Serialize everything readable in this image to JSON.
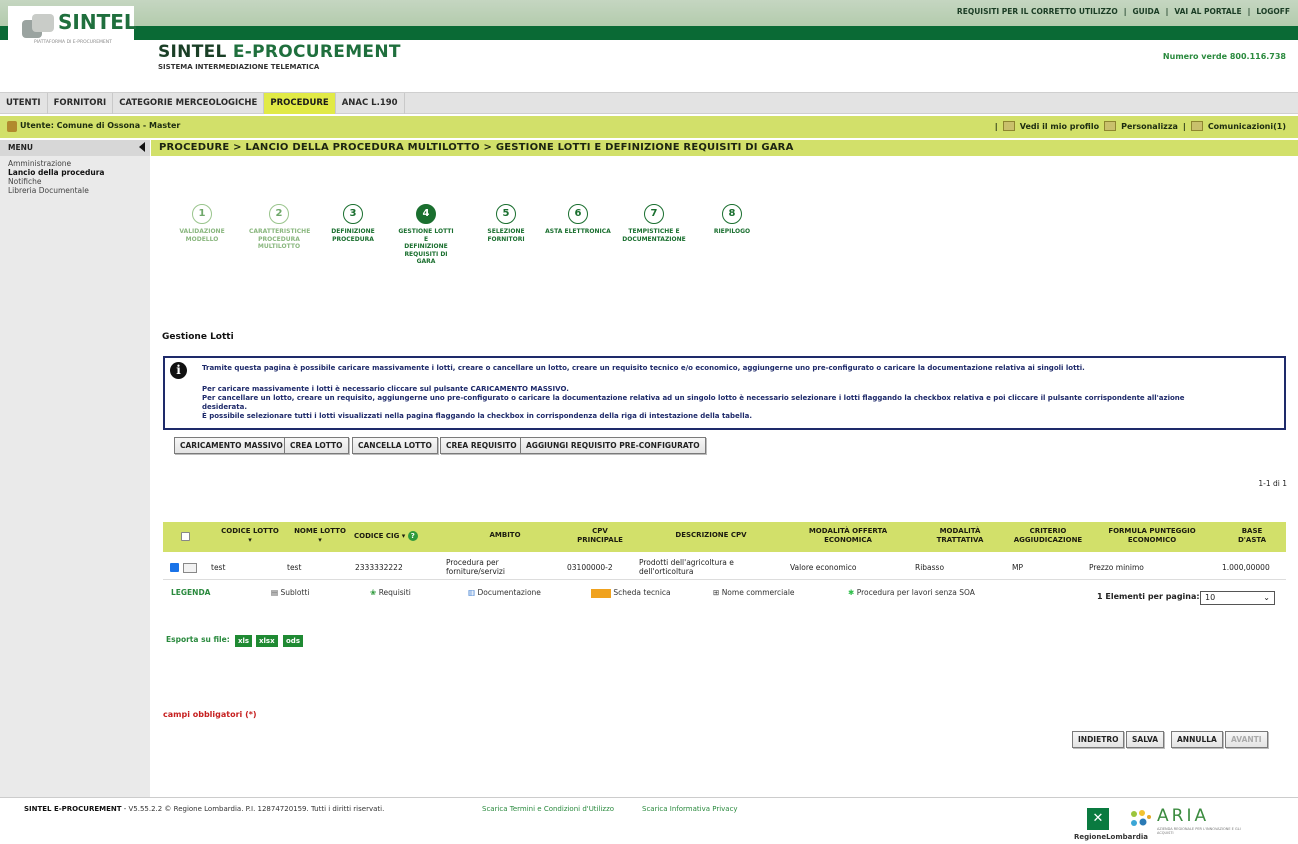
{
  "header": {
    "logo_text": "SINTEL",
    "logo_sub": "PIATTAFORMA DI E-PROCUREMENT",
    "title_part1": "SINTEL",
    "title_part2": "E-PROCUREMENT",
    "subtitle": "SISTEMA INTERMEDIAZIONE TELEMATICA",
    "numero_verde": "Numero verde 800.116.738",
    "top_links": [
      "REQUISITI PER IL CORRETTO UTILIZZO",
      "GUIDA",
      "VAI AL PORTALE",
      "LOGOFF"
    ]
  },
  "nav": {
    "tabs": [
      "UTENTI",
      "FORNITORI",
      "CATEGORIE MERCEOLOGICHE",
      "PROCEDURE",
      "ANAC L.190"
    ],
    "active": "PROCEDURE"
  },
  "userbar": {
    "user": "Utente: Comune di Ossona - Master",
    "profile": "Vedi il mio profilo",
    "personalize": "Personalizza",
    "messages": "Comunicazioni(1)",
    "sep": "|"
  },
  "menu": {
    "title": "MENU",
    "items": [
      "Amministrazione",
      "Lancio della procedura",
      "Notifiche",
      "Libreria Documentale"
    ],
    "current": "Lancio della procedura"
  },
  "breadcrumb": "PROCEDURE  > LANCIO DELLA PROCEDURA MULTILOTTO  > GESTIONE LOTTI E DEFINIZIONE REQUISITI DI GARA",
  "steps": [
    {
      "n": "1",
      "l1": "VALIDAZIONE",
      "l2": "MODELLO",
      "l3": ""
    },
    {
      "n": "2",
      "l1": "CARATTERISTICHE",
      "l2": "PROCEDURA",
      "l3": "MULTILOTTO"
    },
    {
      "n": "3",
      "l1": "DEFINIZIONE",
      "l2": "PROCEDURA",
      "l3": ""
    },
    {
      "n": "4",
      "l1": "GESTIONE LOTTI E",
      "l2": "DEFINIZIONE",
      "l3": "REQUISITI DI GARA"
    },
    {
      "n": "5",
      "l1": "SELEZIONE",
      "l2": "FORNITORI",
      "l3": ""
    },
    {
      "n": "6",
      "l1": "ASTA ELETTRONICA",
      "l2": "",
      "l3": ""
    },
    {
      "n": "7",
      "l1": "TEMPISTICHE E",
      "l2": "DOCUMENTAZIONE",
      "l3": ""
    },
    {
      "n": "8",
      "l1": "RIEPILOGO",
      "l2": "",
      "l3": ""
    }
  ],
  "section_title": "Gestione Lotti",
  "info": {
    "line1": "Tramite questa pagina è possibile caricare massivamente i lotti, creare o cancellare un lotto, creare un requisito tecnico e/o economico, aggiungerne uno pre-configurato o caricare la documentazione relativa ai singoli lotti.",
    "line2": "Per caricare massivamente i lotti è necessario cliccare sul pulsante CARICAMENTO MASSIVO.",
    "line3": "Per cancellare un lotto, creare un requisito, aggiungerne uno pre-configurato o caricare la documentazione relativa ad un singolo lotto è necessario selezionare i lotti flaggando la checkbox relativa e poi cliccare il pulsante corrispondente all'azione",
    "line4": "desiderata.",
    "line5": "È possibile selezionare tutti i lotti visualizzati nella pagina flaggando la checkbox in corrispondenza della riga di intestazione della tabella."
  },
  "buttons": {
    "massivo": "CARICAMENTO MASSIVO",
    "crea_lotto": "CREA LOTTO",
    "cancella_lotto": "CANCELLA LOTTO",
    "crea_requisito": "CREA REQUISITO",
    "aggiungi": "AGGIUNGI REQUISITO PRE-CONFIGURATO"
  },
  "pager_top": "1-1 di 1",
  "table": {
    "headers": {
      "codice_lotto": "CODICE LOTTO",
      "nome_lotto": "NOME LOTTO",
      "codice_cig": "CODICE CIG",
      "ambito": "AMBITO",
      "cpv1": "CPV",
      "cpv2": "PRINCIPALE",
      "descr_cpv": "DESCRIZIONE CPV",
      "mod1": "MODALITÀ OFFERTA",
      "mod2": "ECONOMICA",
      "tratt1": "MODALITÀ",
      "tratt2": "TRATTATIVA",
      "crit1": "CRITERIO",
      "crit2": "AGGIUDICAZIONE",
      "form1": "FORMULA PUNTEGGIO",
      "form2": "ECONOMICO",
      "base1": "BASE",
      "base2": "D'ASTA"
    },
    "row": {
      "codice_lotto": "test",
      "nome_lotto": "test",
      "codice_cig": "2333332222",
      "ambito1": "Procedura per",
      "ambito2": "forniture/servizi",
      "cpv": "03100000-2",
      "descr1": "Prodotti dell'agricoltura e",
      "descr2": "dell'orticoltura",
      "modalita": "Valore economico",
      "trattativa": "Ribasso",
      "criterio": "MP",
      "formula": "Prezzo minimo",
      "base": "1.000,00000"
    }
  },
  "legend": {
    "title": "LEGENDA",
    "sublotti": "Sublotti",
    "requisiti": "Requisiti",
    "documentazione": "Documentazione",
    "scheda": "Scheda tecnica",
    "nome_comm": "Nome commerciale",
    "soa": "Procedura per lavori senza SOA"
  },
  "per_page": {
    "count": "1",
    "label": "Elementi per pagina:",
    "value": "10"
  },
  "export": {
    "label": "Esporta su file:",
    "formats": [
      "xls",
      "xlsx",
      "ods"
    ]
  },
  "required": "campi obbligatori (*)",
  "nav_buttons": {
    "indietro": "INDIETRO",
    "salva": "SALVA",
    "annulla": "ANNULLA",
    "avanti": "AVANTI"
  },
  "footer": {
    "brand": "SINTEL E-PROCUREMENT",
    "text": " - V5.55.2.2 © Regione Lombardia. P.I. 12874720159. Tutti i diritti riservati.",
    "link1": "Scarica Termini e Condizioni d'Utilizzo",
    "link2": "Scarica Informativa Privacy",
    "rl": "RegioneLombardia",
    "aria": "ARIA",
    "aria_sub": "AZIENDA REGIONALE PER L'INNOVAZIONE E GLI ACQUISTI"
  },
  "colors": {
    "dark_green": "#0a6a35",
    "lime": "#d2e06a",
    "accent_tab": "#e1ea46",
    "info_border": "#1e2a6a",
    "required_red": "#c62020"
  }
}
